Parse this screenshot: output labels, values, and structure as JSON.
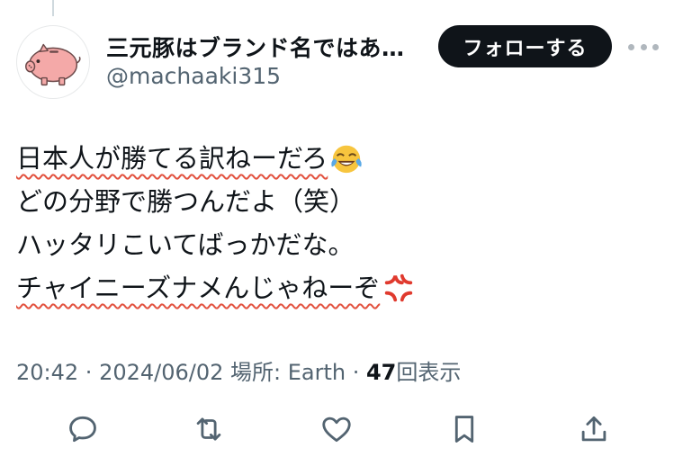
{
  "header": {
    "display_name": "三元豚はブランド名ではあ…",
    "handle": "@machaaki315",
    "follow_label": "フォローする"
  },
  "tweet": {
    "lines": [
      "日本人が勝てる訳ねーだろ",
      "どの分野で勝つんだよ（笑）",
      "ハッタリこいてばっかだな。",
      "チャイニーズナメんじゃねーぞ"
    ],
    "emojis": [
      "face-with-tears-of-joy",
      "anger-symbol"
    ]
  },
  "meta": {
    "time": "20:42",
    "sep1": " · ",
    "date": "2024/06/02",
    "location": " 場所: Earth",
    "sep2": " · ",
    "views_count": "47",
    "views_label": "回表示"
  },
  "actions": [
    "reply-icon",
    "retweet-icon",
    "like-icon",
    "bookmark-icon",
    "share-icon"
  ],
  "colors": {
    "text": "#0f1419",
    "secondary": "#536471",
    "follow_bg": "#0f1419",
    "avatar_pig": "#f4a9a8",
    "underline": "#e2523f"
  }
}
